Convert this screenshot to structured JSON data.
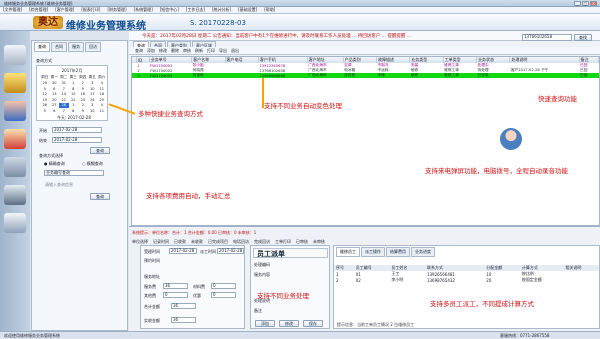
{
  "window": {
    "title": "维修服务业务管理系统 [维修业务管理]"
  },
  "menubar": [
    "[文件管理]",
    "[综合管理]",
    "[客户管理]",
    "[报表打印]",
    "[财务管理]",
    "[系统管理]",
    "[短信中心]",
    "[工作日志]",
    "[统计分析]",
    "[基础设置]",
    "[帮助]"
  ],
  "banner": {
    "logo_text": "奥达",
    "app_title": "维修业务管理系统",
    "version": "S. 20170228-03"
  },
  "ticker": "今天是：2017年02月28日 星期二    公告通知：当前客户中有1个在维修进行中，请及时联系工作人员处理 ... 待回访客户 ... 提醒提醒 ...",
  "search": {
    "value": "13766102658",
    "button": "查找"
  },
  "left": {
    "tabs": [
      "查询",
      "合同",
      "服务",
      "回访"
    ],
    "section_label": "查询方式",
    "calendar_title": "2017年2月",
    "weekdays": [
      "周日",
      "周一",
      "周二",
      "周三",
      "周四",
      "周五",
      "周六"
    ],
    "weeks": [
      [
        "29",
        "30",
        "31",
        "1",
        "2",
        "3",
        "4"
      ],
      [
        "5",
        "6",
        "7",
        "8",
        "9",
        "10",
        "11"
      ],
      [
        "12",
        "13",
        "14",
        "15",
        "16",
        "17",
        "18"
      ],
      [
        "19",
        "20",
        "21",
        "22",
        "23",
        "24",
        "25"
      ],
      [
        "26",
        "27",
        "28",
        "1",
        "2",
        "3",
        "4"
      ],
      [
        "5",
        "6",
        "7",
        "8",
        "9",
        "10",
        "11"
      ]
    ],
    "today_label": "今天: 2017-02-28",
    "start_label": "开始",
    "start_value": "2017-02-28",
    "end_label": "结束",
    "end_value": "2017-02-28",
    "query_btn": "查询",
    "cond_label": "查询方式选择",
    "radio1": "精确查询",
    "radio2": "模糊查询",
    "select_value": "业务编号查询",
    "keyword_placeholder": "请输入查询信息",
    "query_btn2": "查询"
  },
  "main_tabs": [
    "查询",
    "合同",
    "客户类别",
    "客户区域"
  ],
  "toolbar": [
    "查询",
    "添加",
    "修改",
    "删除",
    "审核",
    "刷新",
    "打印",
    "导出",
    "退出"
  ],
  "grid": {
    "headers": [
      "",
      "ID",
      "业务单号",
      "客户名称",
      "客户电话",
      "客户手机",
      "客户地址",
      "产品类别",
      "故障描述",
      "业务类型",
      "工单类型",
      "业务状态",
      "处理说明",
      "备注"
    ],
    "rows": [
      [
        "",
        "1",
        "FW1700001",
        "张小姐",
        "",
        "13912345678",
        "广西北海市",
        "空调",
        "不制冷",
        "安装",
        "维修工单",
        "处理中",
        "",
        "已回"
      ],
      [
        "",
        "2",
        "FW1700002",
        "何晓燕",
        "",
        "13766102658",
        "广西北海市",
        "电冰箱",
        "不运转",
        "维修",
        "维修工单",
        "待处理",
        "客户2017-02-28 下午",
        "已回"
      ],
      [
        "",
        "3",
        "FW1700003",
        "苏宝林",
        "",
        "13986666668",
        "广西北海市",
        "洗衣机",
        "不转",
        "维修",
        "维修工单",
        "已完成",
        "",
        "已回"
      ]
    ]
  },
  "bottom": {
    "info_text": "系统提示：单位名称：合计：1 合计金额：0.00 已审核：0 未审核：1",
    "checks": [
      "单位选择",
      "记录时间",
      "已收款",
      "未收款",
      "已完成项目",
      "电话回访",
      "完成回访",
      "工单打印",
      "已审核",
      "未审核"
    ],
    "tabs": [
      "业务信息",
      "派工服务",
      "财务明细"
    ],
    "form_labels": [
      "受理时间",
      "派工时间",
      "预约时间",
      "服务地址",
      "服务费",
      "材料费",
      "其他费",
      "优惠",
      "合计金额",
      "实收金额"
    ],
    "form_values": [
      "2017-02-28",
      "2017-02-28",
      "",
      "",
      "36",
      "0",
      "0",
      "0",
      "36",
      "36"
    ],
    "dispatch_title": "员工派单",
    "detail_labels": [
      "处理编码",
      "服务内容",
      "处理说明",
      "备注"
    ],
    "detail_btns": [
      "添加",
      "修改",
      "保存"
    ],
    "worker_tabs": [
      "维修员工",
      "派工操作",
      "结算费用",
      "业务进度"
    ],
    "worker_headers": [
      "序号",
      "员工编号",
      "员工姓名",
      "联系方式",
      "分配金额",
      "计算方式",
      "相关说明"
    ],
    "worker_rows": [
      [
        "1",
        "01",
        "王工",
        "13926566481",
        "10",
        "按比例",
        ""
      ],
      [
        "2",
        "02",
        "李小明",
        "13698765432",
        "20",
        "按固定金额",
        ""
      ]
    ],
    "worker_status": "提示信息：当前工单员工情况 2 位维修员工"
  },
  "annotations": {
    "a1": "多种快捷业务查询方式",
    "a2": "支持不同业务自动变色处理",
    "a3": "快速查询功能",
    "a4": "支持来电弹屏功能，电脑拨号，全程自动录音功能",
    "a5": "支持各项费用自动，手动汇总",
    "a6": "支持不同业务处理",
    "a7": "支持多员工派工，不同提成计算方式"
  },
  "status": {
    "left": "欢迎使用维修服务业务管理系统",
    "right": "客服热线：0771-2867558"
  }
}
